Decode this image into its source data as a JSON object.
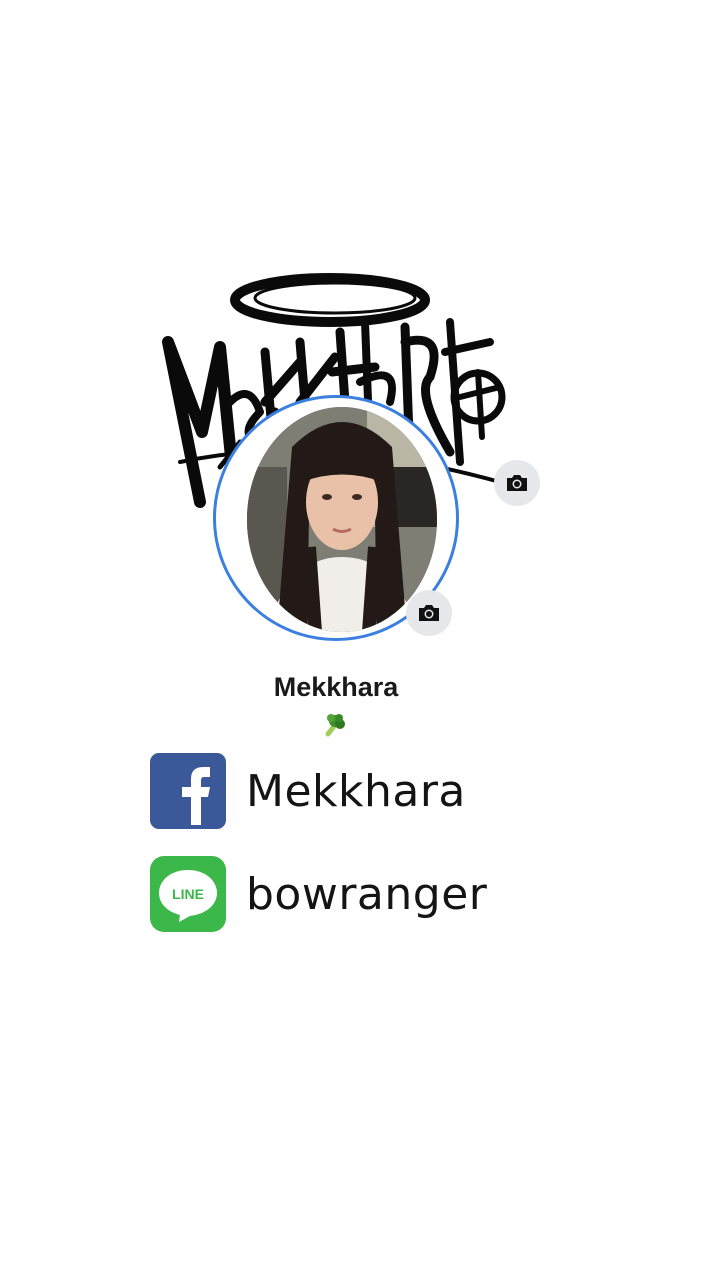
{
  "profile": {
    "name": "Mekkhara",
    "bio_emoji": "broccoli"
  },
  "social": {
    "facebook": {
      "icon": "facebook-logo-icon",
      "handle": "Mekkhara",
      "color": "#3b5998"
    },
    "line": {
      "icon": "line-logo-icon",
      "logo_text": "LINE",
      "handle": "bowranger",
      "color": "#3cb84a"
    }
  },
  "colors": {
    "avatar_ring": "#3b7fe0",
    "camera_button_bg": "#e6e7eb"
  }
}
